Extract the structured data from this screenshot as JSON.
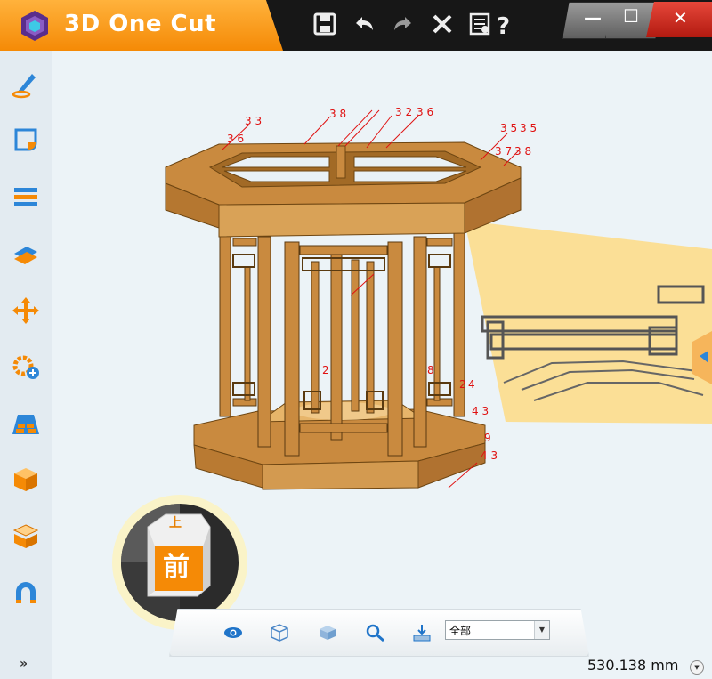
{
  "app": {
    "title": "3D One Cut"
  },
  "titlebar": {
    "icons": [
      "save-icon",
      "undo-icon",
      "redo-icon",
      "close-doc-icon",
      "settings-help-icon"
    ]
  },
  "window_controls": {
    "minimize": "—",
    "maximize": "☐",
    "close": "✕"
  },
  "sidebar": {
    "tools": [
      "sketch-pen-icon",
      "sketch-shape-icon",
      "layer-stack-icon",
      "layer-edit-icon",
      "move-icon",
      "gear-add-icon",
      "layout-nest-icon",
      "box-icon",
      "box-open-icon",
      "magnet-icon"
    ],
    "more": "»"
  },
  "navcube": {
    "front_label": "前",
    "top_label": "上"
  },
  "bottom_toolbar": {
    "icons": [
      "eye-icon",
      "wireframe-cube-icon",
      "shaded-cube-icon",
      "zoom-icon",
      "import-icon"
    ],
    "filter_selected": "全部"
  },
  "status": {
    "zoom_value": "530.138 mm"
  },
  "dimension_labels": {
    "l1": "3 3",
    "l2": "3 6",
    "l3": "3 8",
    "l4": "3 2",
    "l5": "3 6",
    "l6": "3 5",
    "l7": "3 5",
    "l8": "3 7",
    "l9": "3 8",
    "l10": "2",
    "l11": "8",
    "l12": "2",
    "l13": "4",
    "l14": "4 3",
    "l15": "9",
    "l16": "4 3"
  },
  "colors": {
    "accent_orange": "#f58a06",
    "wood": "#c98a3f",
    "wood_dark": "#8a5a20",
    "sheet": "#fbdf96",
    "dimension_red": "#e01010"
  }
}
